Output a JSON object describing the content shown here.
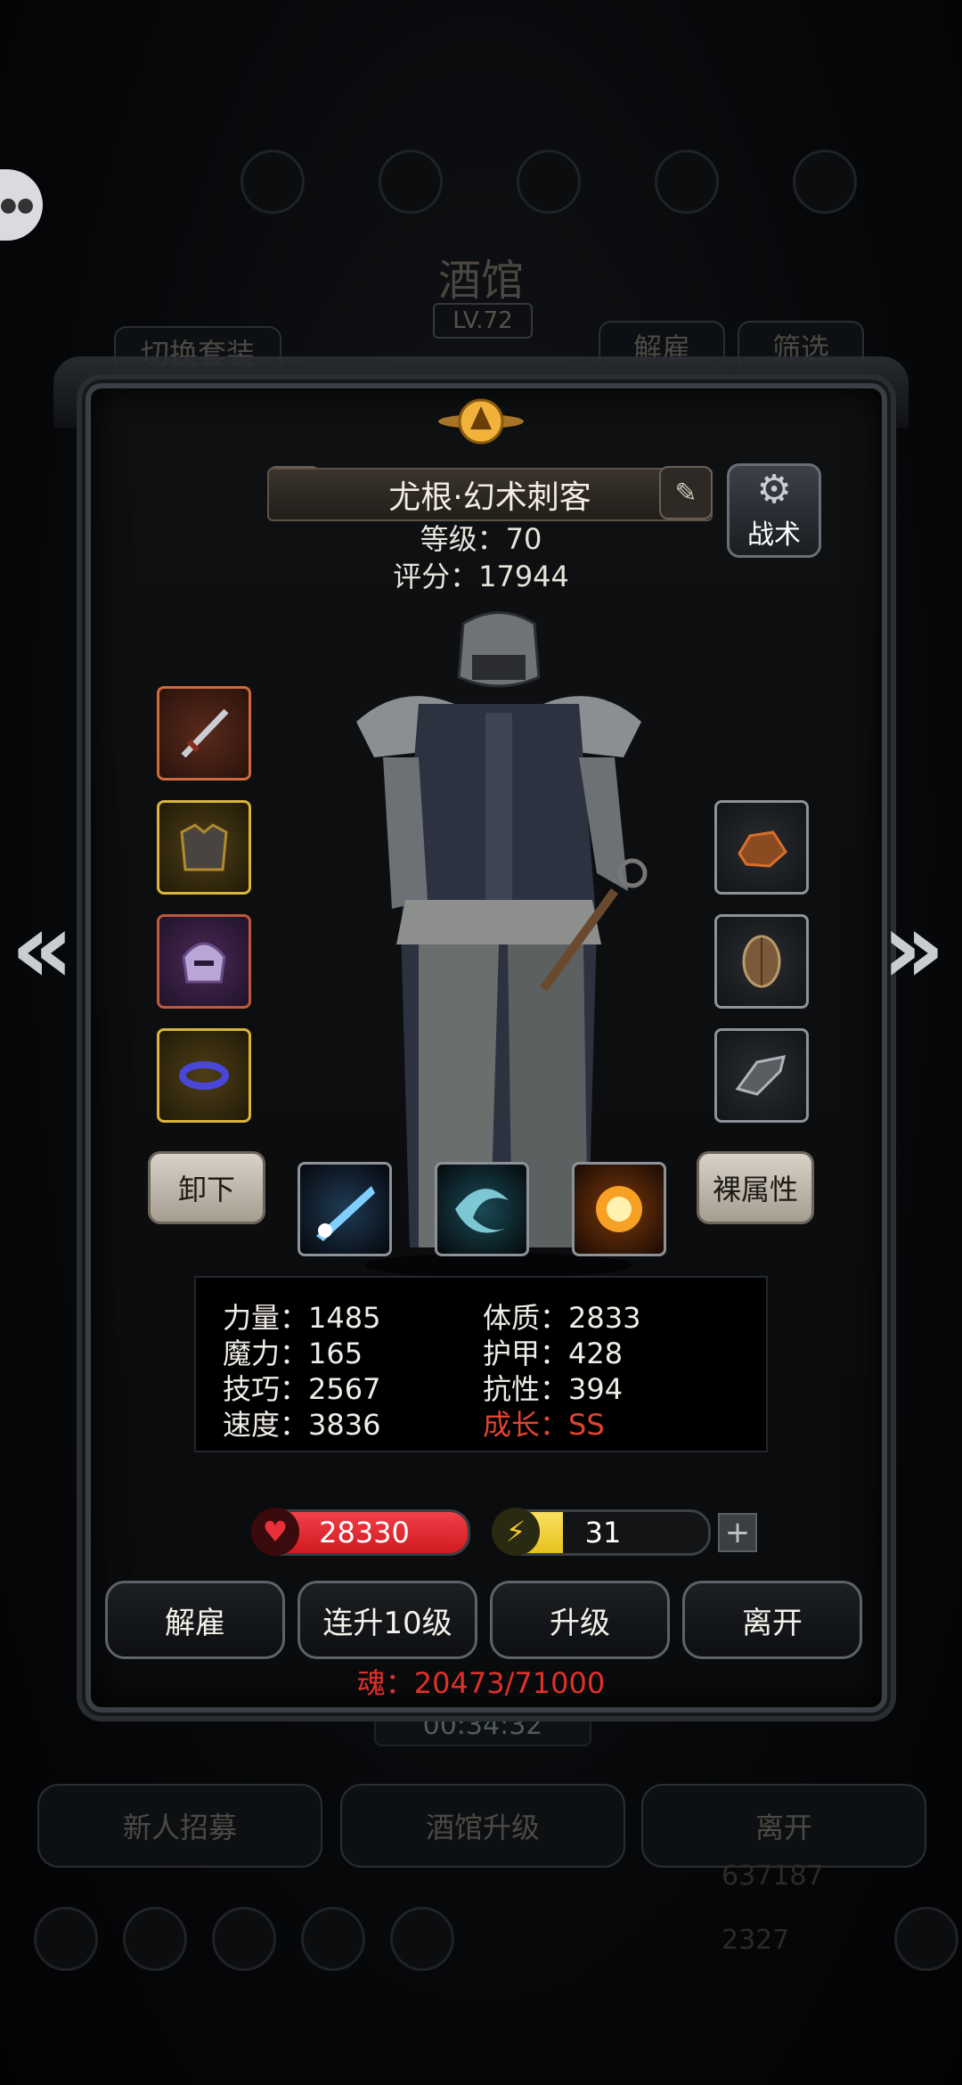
{
  "background": {
    "title": "酒馆",
    "level": "LV.72",
    "switch_outfit": "切换套装",
    "dismiss": "解雇",
    "filter": "筛选",
    "timer": "00:34:32",
    "bottom_buttons": [
      "新人招募",
      "酒馆升级",
      "离开"
    ],
    "gold": "637187",
    "gems": "2327"
  },
  "hero": {
    "name": "尤根·幻术刺客",
    "level_text": "等级：70",
    "score_text": "评分：17944",
    "tactics_label": "战术"
  },
  "equipment": {
    "left": [
      {
        "icon": "dagger-icon",
        "rarity_color": "#d06a3a"
      },
      {
        "icon": "armor-icon",
        "rarity_color": "#d9b53b"
      },
      {
        "icon": "helmet-icon",
        "rarity_color": "#c05a3a"
      },
      {
        "icon": "ring-icon",
        "rarity_color": "#d9b53b"
      }
    ],
    "right": [
      {
        "icon": "ore-icon"
      },
      {
        "icon": "shell-icon"
      },
      {
        "icon": "gauntlet-icon"
      }
    ]
  },
  "buttons": {
    "unequip": "卸下",
    "base_attributes": "裸属性"
  },
  "skills": [
    "light-beam-skill-icon",
    "whirlwind-skill-icon",
    "fire-blast-skill-icon"
  ],
  "stats": {
    "left": [
      "力量：1485",
      "魔力：165",
      "技巧：2567",
      "速度：3836"
    ],
    "right": [
      "体质：2833",
      "护甲：428",
      "抗性：394",
      "成长：SS"
    ]
  },
  "hp": {
    "value": "28330",
    "fill": 1.0,
    "color": "#d11a22"
  },
  "energy": {
    "value": "31",
    "fill": 0.31,
    "color": "#e6c21d"
  },
  "actions": [
    "解雇",
    "连升10级",
    "升级",
    "离开"
  ],
  "soul_text": "魂：20473/71000",
  "colors": {
    "accent_red": "#e0302a",
    "gold": "#d9b53b"
  }
}
